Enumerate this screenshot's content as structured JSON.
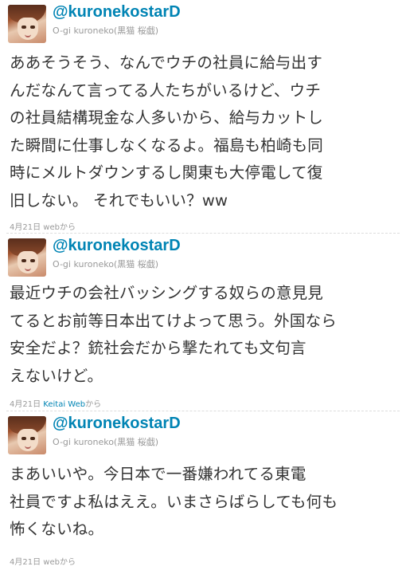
{
  "tweets": [
    {
      "screen_name": "@kuronekostarD",
      "full_name": "O-gi kuroneko(黒猫  桜戯)",
      "avatar_icon": "user-avatar-icon",
      "lines": [
        "ああそうそう、なんでウチの社員に給与出す",
        "んだなんて言ってる人たちがいるけど、ウチ",
        "の社員結構現金な人多いから、給与カットし",
        "た瞬間に仕事しなくなるよ。福島も柏崎も同",
        "時にメルトダウンするし関東も大停電して復",
        "旧しない。  それでもいい？ww"
      ],
      "date": "4月21日",
      "source": "webから"
    },
    {
      "screen_name": "@kuronekostarD",
      "full_name": "O-gi kuroneko(黒猫  桜戯)",
      "avatar_icon": "user-avatar-icon",
      "lines": [
        "最近ウチの会社バッシングする奴らの意見見",
        "てるとお前等日本出てけよって思う。外国なら",
        "安全だよ？銃社会だから撃たれても文句言",
        "えないけど。"
      ],
      "date": "4月21日",
      "source_link": "Keitai Web",
      "source_suffix": "から"
    },
    {
      "screen_name": "@kuronekostarD",
      "full_name": "O-gi kuroneko(黒猫  桜戯)",
      "avatar_icon": "user-avatar-icon",
      "lines": [
        "まあいいや。今日本で一番嫌われてる東電",
        "社員ですよ私はええ。いまさらばらしても何も",
        "怖くないね。"
      ],
      "date": "4月21日",
      "source": "webから"
    }
  ]
}
